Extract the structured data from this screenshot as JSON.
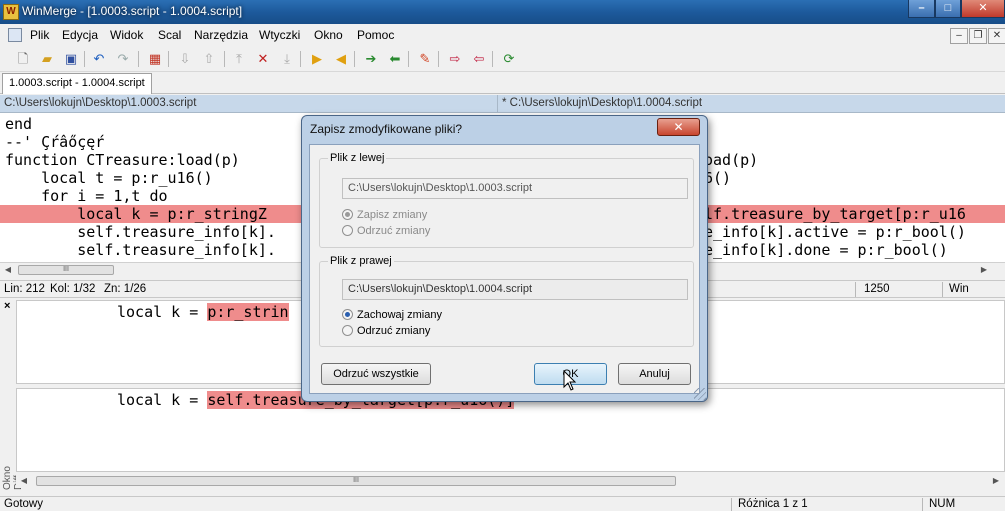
{
  "window": {
    "title": "WinMerge - [1.0003.script - 1.0004.script]",
    "app_icon": "winmerge-icon",
    "controls": {
      "minimize": "–",
      "maximize": "□",
      "close": "✕"
    }
  },
  "menu": {
    "items": [
      "Plik",
      "Edycja",
      "Widok",
      "Scal",
      "Narzędzia",
      "Wtyczki",
      "Okno",
      "Pomoc"
    ],
    "mdi_controls": {
      "minimize": "–",
      "restore": "❐",
      "close": "✕"
    }
  },
  "toolbar": {
    "icons": [
      "new-icon",
      "open-icon",
      "save-icon",
      "undo-icon",
      "redo-icon",
      "filter-icon",
      "prev-conflict-icon",
      "next-conflict-icon",
      "first-diff-icon",
      "current-diff-icon",
      "last-diff-icon",
      "next-diff-icon",
      "prev-diff-icon",
      "copy-right-icon",
      "copy-left-icon",
      "copy-right-advance-icon",
      "copy-left-advance-icon",
      "options-icon",
      "open-left-icon",
      "open-right-icon",
      "refresh-icon"
    ]
  },
  "tabs": [
    {
      "label": "1.0003.script - 1.0004.script"
    }
  ],
  "panes": {
    "left_path": "C:\\Users\\lokujn\\Desktop\\1.0003.script",
    "right_path": "* C:\\Users\\lokujn\\Desktop\\1.0004.script"
  },
  "editor": {
    "lines": [
      {
        "left": "end",
        "right": ""
      },
      {
        "left": "--' Çŕâőçęŕ",
        "right": ""
      },
      {
        "left": "function CTreasure:load(p)",
        "right": "oad(p)"
      },
      {
        "left": "    local t = p:r_u16()",
        "right": "6()"
      },
      {
        "left": "    for i = 1,t do",
        "right": ""
      },
      {
        "left": "        local k = p:r_stringZ",
        "right": "lf.treasure_by_target[p:r_u16"
      },
      {
        "left": "        self.treasure_info[k].",
        "right": "e_info[k].active = p:r_bool()"
      },
      {
        "left": "        self.treasure_info[k].",
        "right": "e_info[k].done = p:r_bool()"
      }
    ],
    "hscroll_thumb": "III"
  },
  "status_mid": {
    "position": "Lin: 212",
    "column": "Kol: 1/32",
    "chars": "Zn: 1/26",
    "right_number": "1250",
    "eol": "Win"
  },
  "diff_pane": {
    "label": "Okno Diff",
    "close": "×",
    "top_prefix": "local k = ",
    "top_highlight": "p:r_strin",
    "bottom_prefix": "local k = ",
    "bottom_highlight": "self.treasure_by_target[p:r_u16()]",
    "hscroll_thumb": "III"
  },
  "bottom_status": {
    "left": "Gotowy",
    "diff": "Różnica 1 z 1",
    "num": "NUM"
  },
  "dialog": {
    "title": "Zapisz zmodyfikowane pliki?",
    "close": "✕",
    "left_group": {
      "label": "Plik z lewej",
      "path": "C:\\Users\\lokujn\\Desktop\\1.0003.script",
      "options": [
        "Zapisz zmiany",
        "Odrzuć zmiany"
      ],
      "selected": 0,
      "enabled": false
    },
    "right_group": {
      "label": "Plik z prawej",
      "path": "C:\\Users\\lokujn\\Desktop\\1.0004.script",
      "options": [
        "Zachowaj zmiany",
        "Odrzuć zmiany"
      ],
      "selected": 0,
      "enabled": true
    },
    "buttons": {
      "discard_all": "Odrzuć wszystkie",
      "ok": "OK",
      "cancel": "Anuluj"
    }
  }
}
